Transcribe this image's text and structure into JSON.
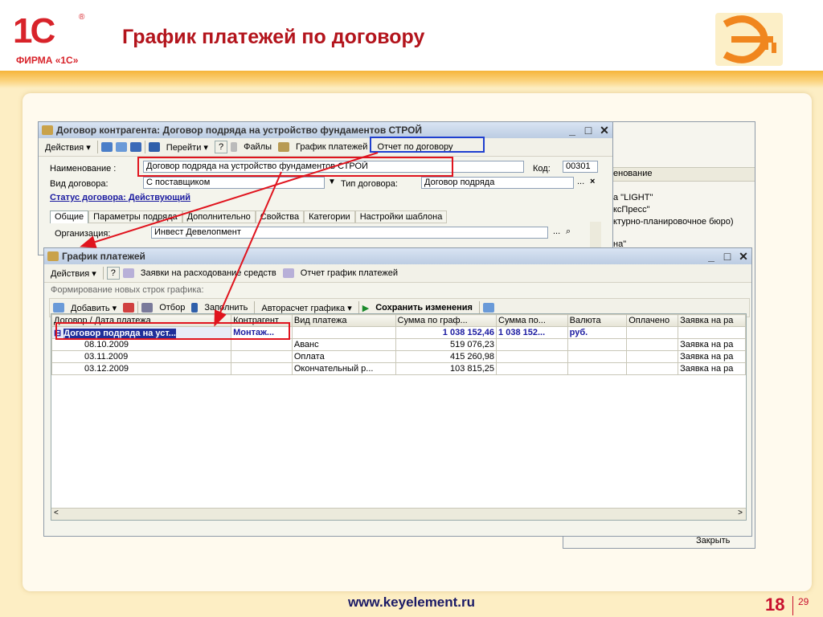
{
  "slide": {
    "title": "График платежей по договору",
    "logo_mark": "1С",
    "logo_reg": "®",
    "logo_text": "ФИРМА «1С»",
    "footer_url": "www.keyelement.ru",
    "page_number": "18",
    "page_total": "29"
  },
  "contract_window": {
    "title": "Договор контрагента: Договор подряда на устройство фундаментов СТРОЙ",
    "toolbar": [
      "Действия ▾",
      "Перейти ▾",
      "?",
      "Файлы",
      "График платежей",
      "Отчет по договору"
    ],
    "name_label": "Наименование :",
    "name_value": "Договор подряда на устройство фундаментов СТРОЙ",
    "code_label": "Код:",
    "code_value": "00301",
    "kind_label": "Вид договора:",
    "kind_value": "С поставщиком",
    "type_label": "Тип договора:",
    "type_value": "Договор подряда",
    "status": "Статус договора: Действующий",
    "tabs": [
      "Общие",
      "Параметры подряда",
      "Дополнительно",
      "Свойства",
      "Категории",
      "Настройки шаблона"
    ],
    "org_label": "Организация:",
    "org_value": "Инвест Девелопмент"
  },
  "bg_window": {
    "header": "енование",
    "rows": [
      "а \"LIGHT\"",
      "ксПресс\"",
      "ктурно-планировочное бюро)",
      "на\""
    ],
    "close_button": "Закрыть"
  },
  "schedule_window": {
    "title": "График платежей",
    "toolbar": [
      "Действия ▾",
      "?",
      "Заявки на расходование средств",
      "Отчет график платежей"
    ],
    "section_label": "Формирование новых строк графика:",
    "toolbar2": [
      "Добавить ▾",
      "Отбор",
      "Заполнить",
      "Авторасчет графика ▾",
      "Сохранить изменения"
    ],
    "columns": [
      "Договор / Дата платежа",
      "Контрагент",
      "Вид платежа",
      "Сумма по граф...",
      "Сумма по...",
      "Валюта",
      "Оплачено",
      "Заявка на ра"
    ],
    "rows": [
      {
        "c0": "Договор подряда на уст...",
        "c1": "Монтаж...",
        "c2": "",
        "c3": "1 038 152,46",
        "c4": "1 038 152...",
        "c5": "руб.",
        "c6": "",
        "c7": ""
      },
      {
        "c0": "08.10.2009",
        "c1": "",
        "c2": "Аванс",
        "c3": "519 076,23",
        "c4": "",
        "c5": "",
        "c6": "",
        "c7": "Заявка на ра"
      },
      {
        "c0": "03.11.2009",
        "c1": "",
        "c2": "Оплата",
        "c3": "415 260,98",
        "c4": "",
        "c5": "",
        "c6": "",
        "c7": "Заявка на ра"
      },
      {
        "c0": "03.12.2009",
        "c1": "",
        "c2": "Окончательный р...",
        "c3": "103 815,25",
        "c4": "",
        "c5": "",
        "c6": "",
        "c7": "Заявка на ра"
      }
    ]
  },
  "colors": {
    "title": "#b3141c",
    "accent": "#d8232a",
    "highlight": "#e0141e",
    "link_box": "#1f3fcf"
  }
}
